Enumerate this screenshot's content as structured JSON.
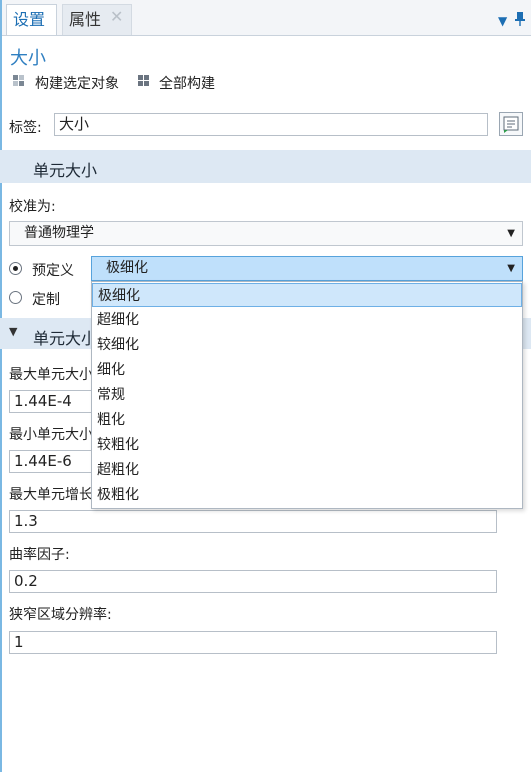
{
  "tabs": {
    "settings": "设置",
    "properties": "属性"
  },
  "node_title": "大小",
  "build": {
    "selected": "构建选定对象",
    "all": "全部构建"
  },
  "label_field": {
    "label": "标签:",
    "value": "大小"
  },
  "section_element_size": {
    "title": "单元大小",
    "calibrate_label": "校准为:",
    "calibrate_value": "普通物理学",
    "predefined_label": "预定义",
    "predefined_value": "极细化",
    "custom_label": "定制",
    "options": [
      "极细化",
      "超细化",
      "较细化",
      "细化",
      "常规",
      "粗化",
      "较粗化",
      "超粗化",
      "极粗化"
    ]
  },
  "section_parameters": {
    "title_visible": "单元大小",
    "max_size_label_visible": "最大单元大小",
    "max_size_value": "1.44E-4",
    "min_size_label_visible": "最小单元大小",
    "min_size_value": "1.44E-6",
    "growth_label_visible": "最大单元增长",
    "growth_value": "1.3",
    "curvature_label": "曲率因子:",
    "curvature_value": "0.2",
    "narrow_label": "狭窄区域分辨率:",
    "narrow_value": "1"
  },
  "colors": {
    "accent": "#1c6eb3",
    "section_bg": "#dde8f3",
    "selection_bg": "#bfe0fb"
  }
}
